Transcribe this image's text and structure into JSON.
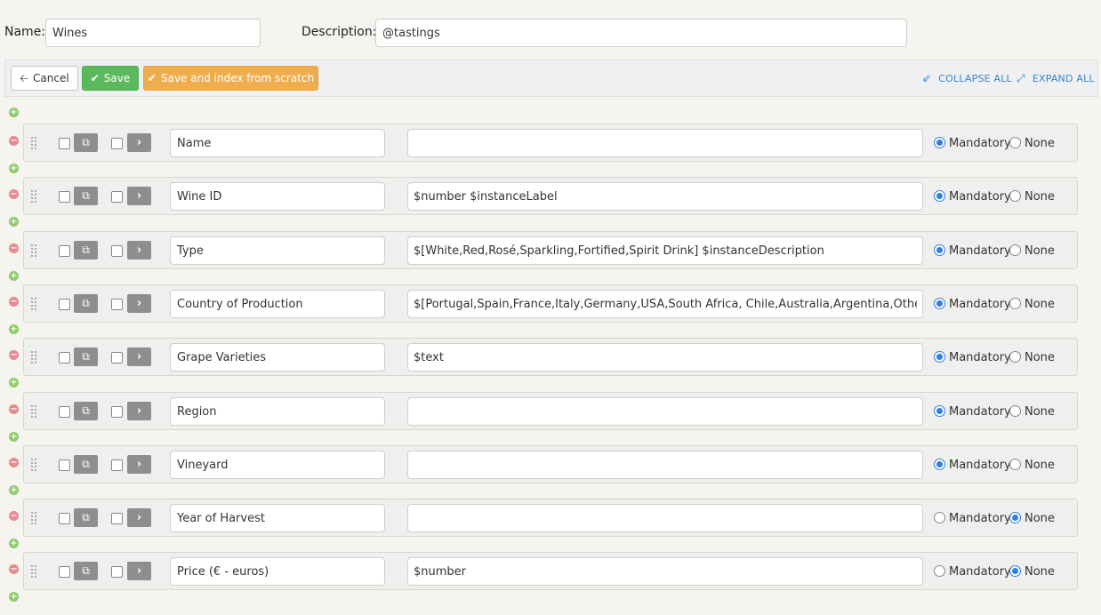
{
  "header": {
    "name_label": "Name:",
    "name_value": "Wines",
    "description_label": "Description:",
    "description_value": "@tastings"
  },
  "toolbar": {
    "cancel_label": "Cancel",
    "save_label": "Save",
    "save_index_label": "Save and index from scratch",
    "collapse_label": "COLLAPSE ALL",
    "expand_label": "EXPAND ALL"
  },
  "colors": {
    "save_green": "#5cb85c",
    "index_orange": "#f0ad4e",
    "link_blue": "#3a86c8",
    "radio_blue": "#2e7fe0",
    "add_green": "#8fc96c",
    "remove_red": "#e58a8e"
  },
  "option_labels": {
    "mandatory": "Mandatory",
    "none": "None"
  },
  "fields": [
    {
      "name": "Name",
      "pattern": "",
      "mandatory": true
    },
    {
      "name": "Wine ID",
      "pattern": "$number $instanceLabel",
      "mandatory": true
    },
    {
      "name": "Type",
      "pattern": "$[White,Red,Rosé,Sparkling,Fortified,Spirit Drink] $instanceDescription",
      "mandatory": true
    },
    {
      "name": "Country of Production",
      "pattern": "$[Portugal,Spain,France,Italy,Germany,USA,South Africa, Chile,Australia,Argentina,Other]",
      "mandatory": true
    },
    {
      "name": "Grape Varieties",
      "pattern": "$text",
      "mandatory": true
    },
    {
      "name": "Region",
      "pattern": "",
      "mandatory": true
    },
    {
      "name": "Vineyard",
      "pattern": "",
      "mandatory": true
    },
    {
      "name": "Year of Harvest",
      "pattern": "",
      "mandatory": false
    },
    {
      "name": "Price (€ - euros)",
      "pattern": "$number",
      "mandatory": false
    }
  ],
  "icons": {
    "cancel": "arrow-left-icon",
    "save": "check-icon",
    "index": "check-icon",
    "collapse": "collapse-arrows-icon",
    "expand": "expand-arrows-icon",
    "add": "plus-circle-icon",
    "remove": "minus-circle-icon",
    "drag": "drag-handle-icon",
    "copy": "copy-icon",
    "details": "chevron-right-icon"
  }
}
